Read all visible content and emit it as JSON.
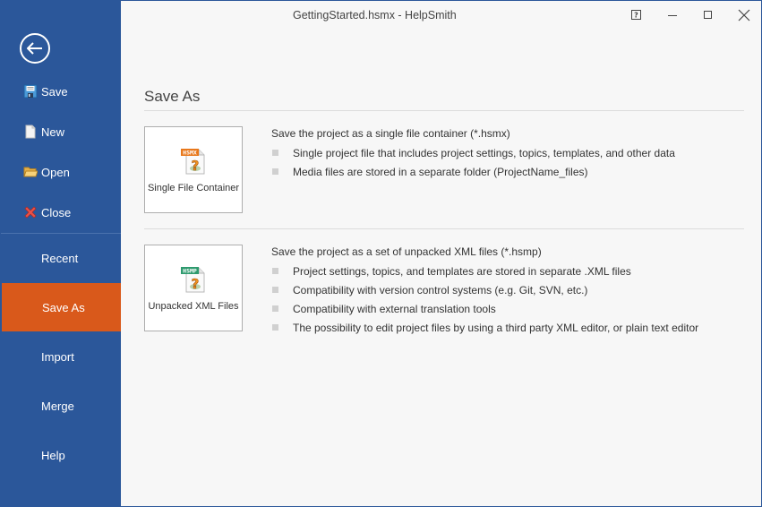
{
  "window": {
    "title": "GettingStarted.hsmx - HelpSmith",
    "controls": [
      "help",
      "minimize",
      "maximize",
      "close"
    ]
  },
  "sidebar": {
    "back_icon": "back-arrow-circle-icon",
    "commands": [
      {
        "label": "Save",
        "icon": "floppy-disk-icon"
      },
      {
        "label": "New",
        "icon": "new-document-icon"
      },
      {
        "label": "Open",
        "icon": "open-folder-icon"
      },
      {
        "label": "Close",
        "icon": "red-x-icon"
      }
    ],
    "tabs": [
      {
        "label": "Recent",
        "active": false
      },
      {
        "label": "Save As",
        "active": true
      },
      {
        "label": "Import",
        "active": false
      },
      {
        "label": "Merge",
        "active": false
      },
      {
        "label": "Help",
        "active": false
      }
    ]
  },
  "main": {
    "title": "Save As",
    "options": [
      {
        "tile_label": "Single File Container",
        "icon_badge": "HSMX",
        "badge_color": "#e8781c",
        "description": "Save the project as a single file container (*.hsmx)",
        "bullets": [
          "Single project file that includes project settings, topics, templates, and other data",
          "Media files are stored in a separate folder (ProjectName_files)"
        ]
      },
      {
        "tile_label": "Unpacked XML Files",
        "icon_badge": "HSMP",
        "badge_color": "#2e9a6e",
        "description": "Save the project as a set of unpacked XML files (*.hsmp)",
        "bullets": [
          "Project settings, topics, and templates are stored in separate .XML files",
          "Compatibility with version control systems (e.g. Git, SVN, etc.)",
          "Compatibility with external translation tools",
          "The possibility to edit project files by using a third party XML editor, or plain text editor"
        ]
      }
    ]
  },
  "colors": {
    "sidebar_bg": "#2b579a",
    "active_tab": "#d9591b",
    "content_bg": "#f7f7f7"
  }
}
